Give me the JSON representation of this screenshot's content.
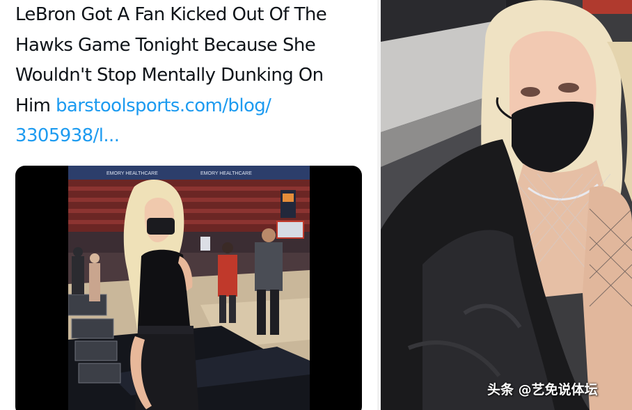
{
  "tweet": {
    "text_lines": [
      "LeBron Got A Fan Kicked Out Of The",
      "Hawks Game Tonight Because She",
      "Wouldn't Stop Mentally Dunking On",
      "Him "
    ],
    "link_part1": "barstoolsports.com/blog/",
    "link_part2": "3305938/l..."
  },
  "media": {
    "banner_text": "EMORY HEALTHCARE",
    "banner_text_2": "EMORY HEALTHCARE"
  },
  "watermark": {
    "text": "头条 @艺免说体坛"
  },
  "colors": {
    "link": "#1d9bf0",
    "text": "#0f1419",
    "card_bg": "#000000"
  }
}
